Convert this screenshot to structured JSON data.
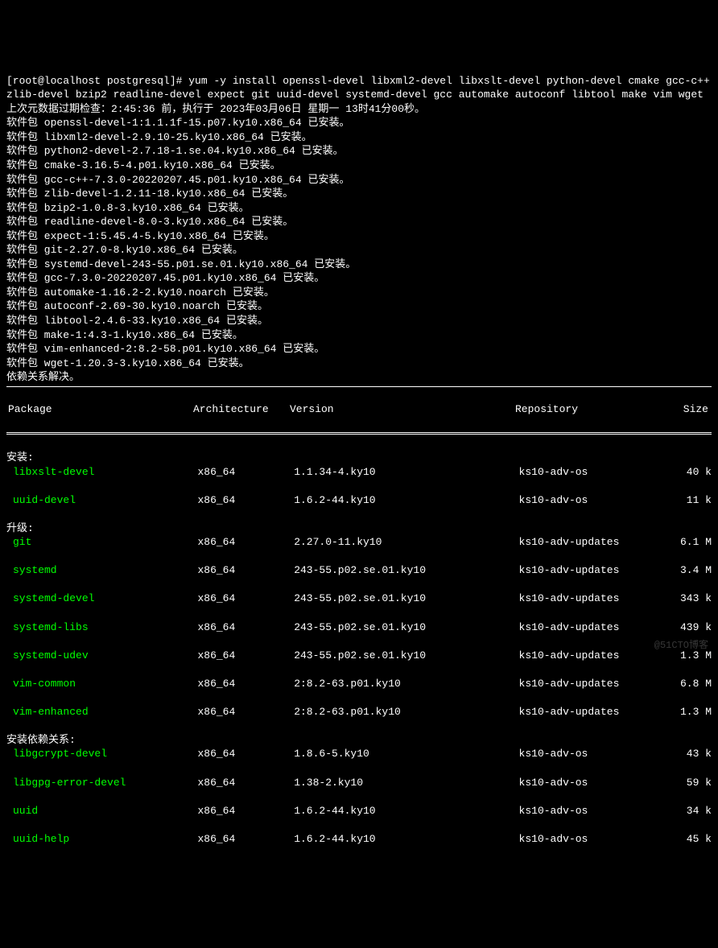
{
  "prompt": "[root@localhost postgresql]# ",
  "command": "yum -y install openssl-devel libxml2-devel libxslt-devel python-devel cmake gcc-c++ zlib-devel bzip2 readline-devel expect git uuid-devel systemd-devel gcc automake autoconf libtool make vim wget",
  "meta_line": "上次元数据过期检查：2:45:36 前，执行于 2023年03月06日 星期一 13时41分00秒。",
  "installed": [
    "软件包 openssl-devel-1:1.1.1f-15.p07.ky10.x86_64 已安装。",
    "软件包 libxml2-devel-2.9.10-25.ky10.x86_64 已安装。",
    "软件包 python2-devel-2.7.18-1.se.04.ky10.x86_64 已安装。",
    "软件包 cmake-3.16.5-4.p01.ky10.x86_64 已安装。",
    "软件包 gcc-c++-7.3.0-20220207.45.p01.ky10.x86_64 已安装。",
    "软件包 zlib-devel-1.2.11-18.ky10.x86_64 已安装。",
    "软件包 bzip2-1.0.8-3.ky10.x86_64 已安装。",
    "软件包 readline-devel-8.0-3.ky10.x86_64 已安装。",
    "软件包 expect-1:5.45.4-5.ky10.x86_64 已安装。",
    "软件包 git-2.27.0-8.ky10.x86_64 已安装。",
    "软件包 systemd-devel-243-55.p01.se.01.ky10.x86_64 已安装。",
    "软件包 gcc-7.3.0-20220207.45.p01.ky10.x86_64 已安装。",
    "软件包 automake-1.16.2-2.ky10.noarch 已安装。",
    "软件包 autoconf-2.69-30.ky10.noarch 已安装。",
    "软件包 libtool-2.4.6-33.ky10.x86_64 已安装。",
    "软件包 make-1:4.3-1.ky10.x86_64 已安装。",
    "软件包 vim-enhanced-2:8.2-58.p01.ky10.x86_64 已安装。",
    "软件包 wget-1.20.3-3.ky10.x86_64 已安装。"
  ],
  "dep_resolved": "依赖关系解决。",
  "headers": {
    "pkg": "Package",
    "arch": "Architecture",
    "ver": "Version",
    "repo": "Repository",
    "size": "Size"
  },
  "sections": {
    "install": "安装:",
    "upgrade": "升级:",
    "deps": "安装依赖关系:"
  },
  "install_rows": [
    {
      "pkg": "libxslt-devel",
      "arch": "x86_64",
      "ver": "1.1.34-4.ky10",
      "repo": "ks10-adv-os",
      "size": "40 k"
    },
    {
      "pkg": "uuid-devel",
      "arch": "x86_64",
      "ver": "1.6.2-44.ky10",
      "repo": "ks10-adv-os",
      "size": "11 k"
    }
  ],
  "upgrade_rows": [
    {
      "pkg": "git",
      "arch": "x86_64",
      "ver": "2.27.0-11.ky10",
      "repo": "ks10-adv-updates",
      "size": "6.1 M"
    },
    {
      "pkg": "systemd",
      "arch": "x86_64",
      "ver": "243-55.p02.se.01.ky10",
      "repo": "ks10-adv-updates",
      "size": "3.4 M"
    },
    {
      "pkg": "systemd-devel",
      "arch": "x86_64",
      "ver": "243-55.p02.se.01.ky10",
      "repo": "ks10-adv-updates",
      "size": "343 k"
    },
    {
      "pkg": "systemd-libs",
      "arch": "x86_64",
      "ver": "243-55.p02.se.01.ky10",
      "repo": "ks10-adv-updates",
      "size": "439 k"
    },
    {
      "pkg": "systemd-udev",
      "arch": "x86_64",
      "ver": "243-55.p02.se.01.ky10",
      "repo": "ks10-adv-updates",
      "size": "1.3 M"
    },
    {
      "pkg": "vim-common",
      "arch": "x86_64",
      "ver": "2:8.2-63.p01.ky10",
      "repo": "ks10-adv-updates",
      "size": "6.8 M"
    },
    {
      "pkg": "vim-enhanced",
      "arch": "x86_64",
      "ver": "2:8.2-63.p01.ky10",
      "repo": "ks10-adv-updates",
      "size": "1.3 M"
    }
  ],
  "dep_rows": [
    {
      "pkg": "libgcrypt-devel",
      "arch": "x86_64",
      "ver": "1.8.6-5.ky10",
      "repo": "ks10-adv-os",
      "size": "43 k"
    },
    {
      "pkg": "libgpg-error-devel",
      "arch": "x86_64",
      "ver": "1.38-2.ky10",
      "repo": "ks10-adv-os",
      "size": "59 k"
    },
    {
      "pkg": "uuid",
      "arch": "x86_64",
      "ver": "1.6.2-44.ky10",
      "repo": "ks10-adv-os",
      "size": "34 k"
    },
    {
      "pkg": "uuid-help",
      "arch": "x86_64",
      "ver": "1.6.2-44.ky10",
      "repo": "ks10-adv-os",
      "size": "45 k"
    }
  ],
  "watermark": "@51CTO博客"
}
